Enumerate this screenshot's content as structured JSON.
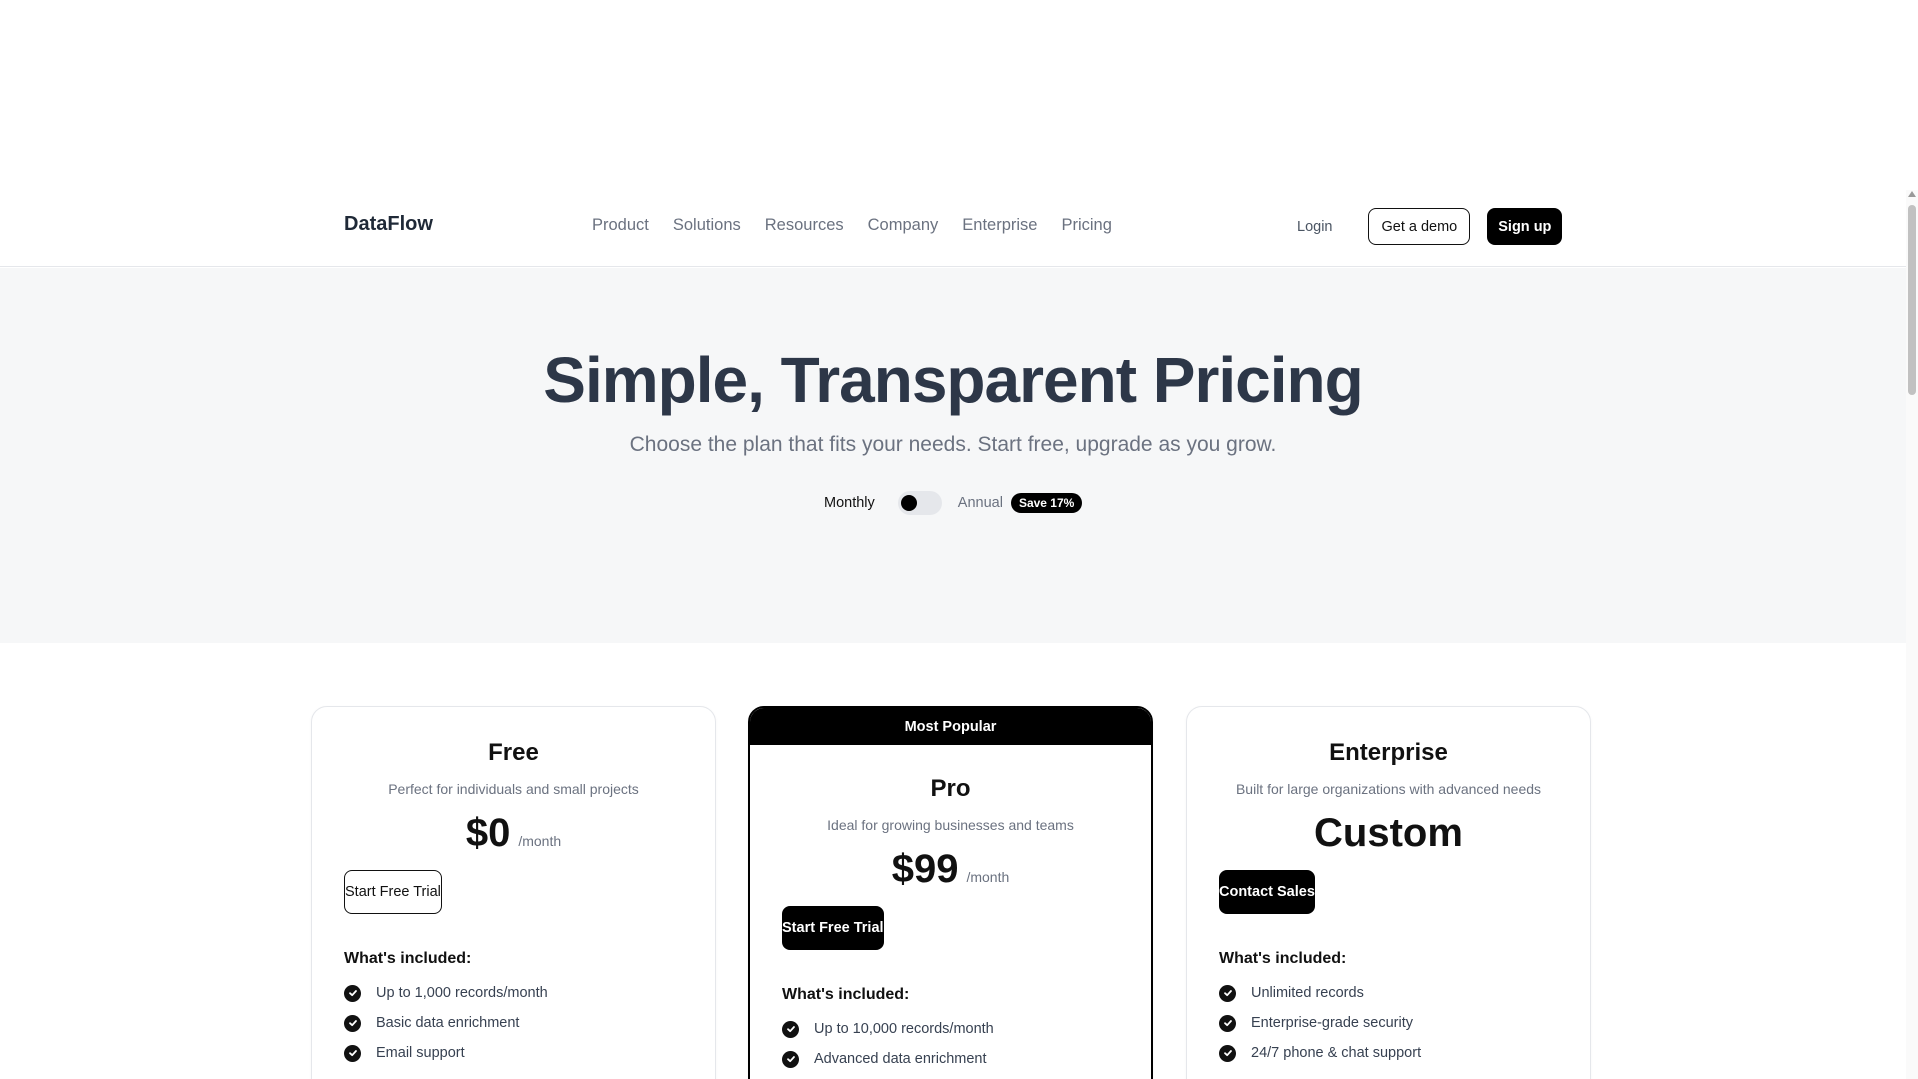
{
  "header": {
    "logo": "DataFlow",
    "nav": [
      "Product",
      "Solutions",
      "Resources",
      "Company",
      "Enterprise",
      "Pricing"
    ],
    "login": "Login",
    "demo": "Get a demo",
    "signup": "Sign up"
  },
  "hero": {
    "title": "Simple, Transparent Pricing",
    "subtitle": "Choose the plan that fits your needs. Start free, upgrade as you grow.",
    "monthly": "Monthly",
    "annual": "Annual",
    "save": "Save 17%",
    "billing_annual_on": false
  },
  "plans": {
    "free": {
      "name": "Free",
      "desc": "Perfect for individuals and small projects",
      "price": "$0",
      "per": "/month",
      "cta": "Start Free Trial",
      "included": "What's included:",
      "features": [
        "Up to 1,000 records/month",
        "Basic data enrichment",
        "Email support"
      ]
    },
    "pro": {
      "badge": "Most Popular",
      "name": "Pro",
      "desc": "Ideal for growing businesses and teams",
      "price": "$99",
      "per": "/month",
      "cta": "Start Free Trial",
      "included": "What's included:",
      "features": [
        "Up to 10,000 records/month",
        "Advanced data enrichment"
      ]
    },
    "enterprise": {
      "name": "Enterprise",
      "desc": "Built for large organizations with advanced needs",
      "price": "Custom",
      "cta": "Contact Sales",
      "included": "What's included:",
      "features": [
        "Unlimited records",
        "Enterprise-grade security",
        "24/7 phone & chat support"
      ]
    }
  },
  "icons": {
    "check": "check-circle-icon"
  },
  "colors": {
    "accent": "#000000",
    "hero_bg": "#f6f7f8",
    "muted": "#6b7280"
  }
}
